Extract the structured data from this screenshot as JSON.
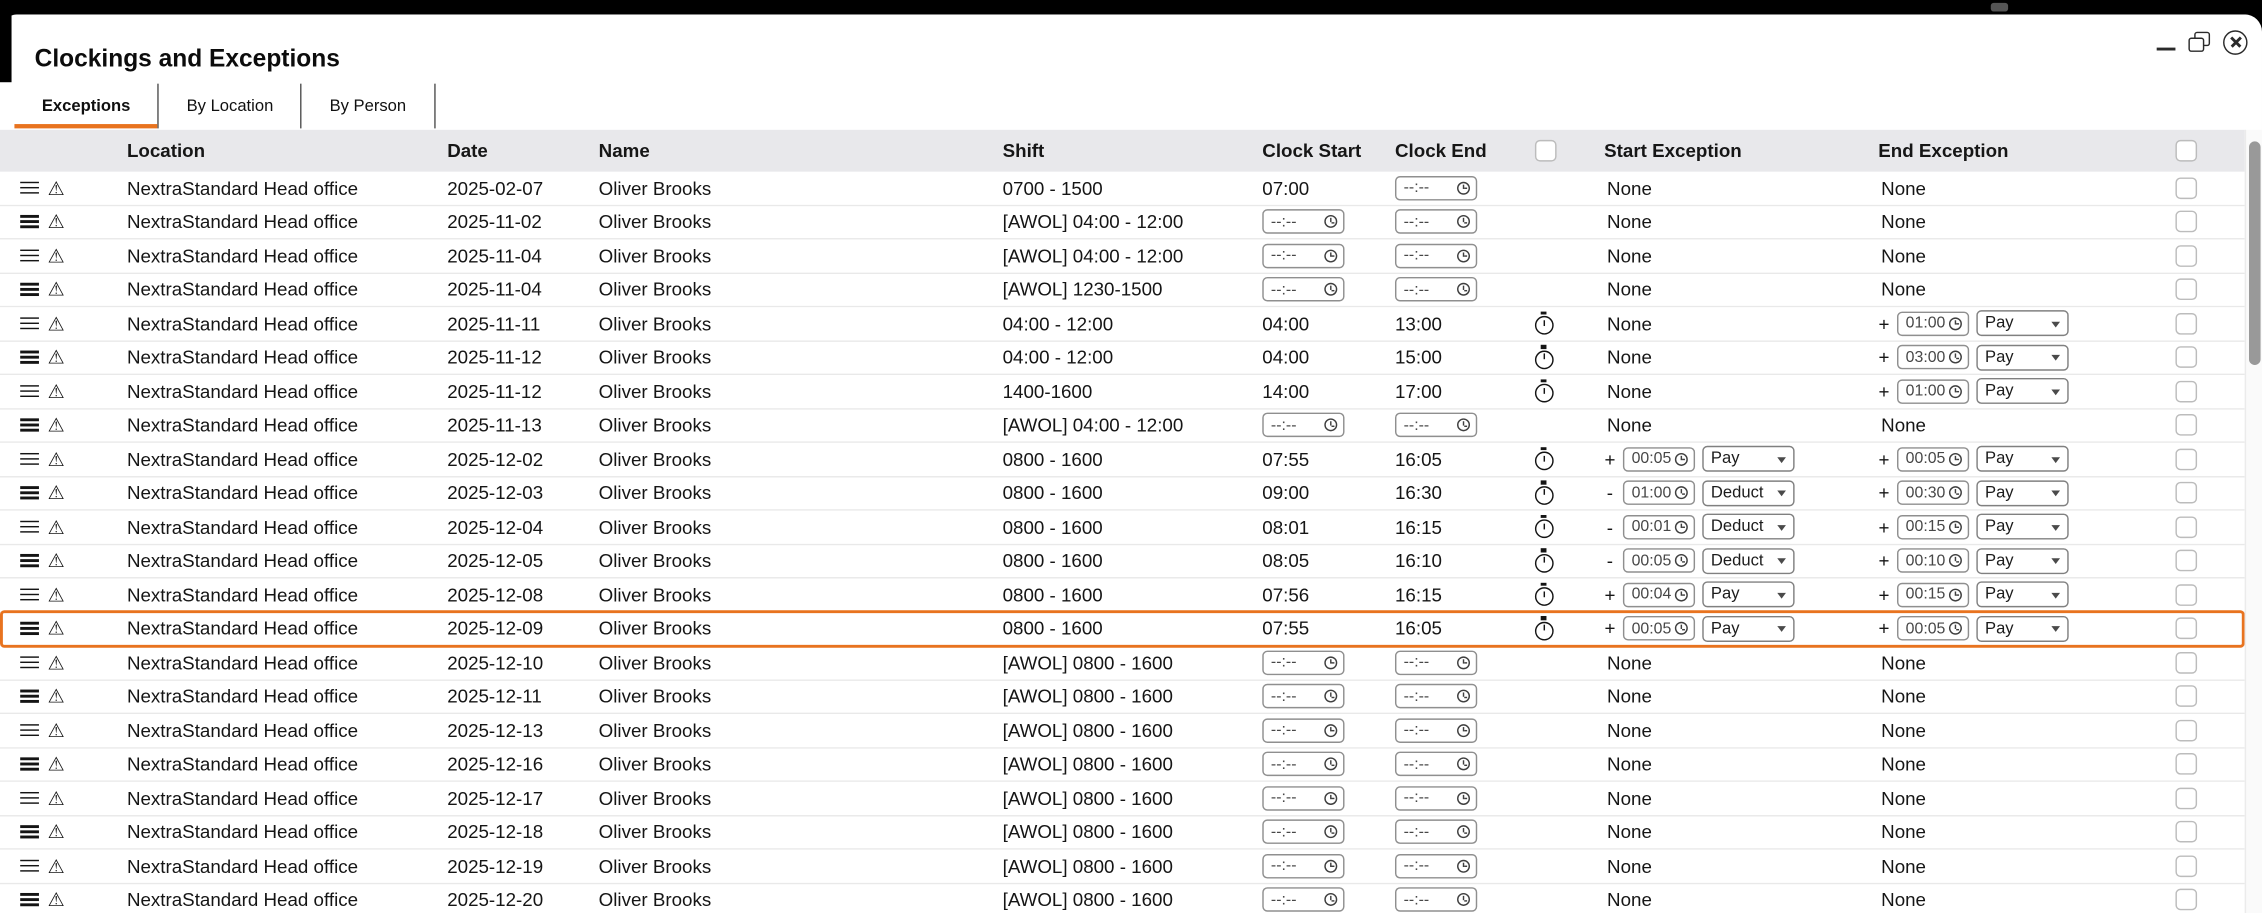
{
  "window": {
    "title": "Clockings and Exceptions"
  },
  "tabs": [
    {
      "label": "Exceptions",
      "active": true
    },
    {
      "label": "By Location",
      "active": false
    },
    {
      "label": "By Person",
      "active": false
    }
  ],
  "icons": {
    "warning": "⚠"
  },
  "colors": {
    "accent": "#e8731f",
    "header_bg": "#e8e8eb"
  },
  "table": {
    "headers": {
      "location": "Location",
      "date": "Date",
      "name": "Name",
      "shift": "Shift",
      "clock_start": "Clock Start",
      "clock_end": "Clock End",
      "start_exception": "Start Exception",
      "end_exception": "End Exception"
    },
    "none_label": "None",
    "time_placeholder": "--:--",
    "rows": [
      {
        "location": "NextraStandard Head office",
        "date": "2025-02-07",
        "name": "Oliver Brooks",
        "shift": "0700 - 1500",
        "clock_start": "07:00",
        "clock_end": null,
        "timer_icon": false,
        "start_exception": null,
        "end_exception": null,
        "highlighted": false
      },
      {
        "location": "NextraStandard Head office",
        "date": "2025-11-02",
        "name": "Oliver Brooks",
        "shift": "[AWOL] 04:00 - 12:00",
        "clock_start": null,
        "clock_end": null,
        "timer_icon": false,
        "start_exception": null,
        "end_exception": null,
        "highlighted": false
      },
      {
        "location": "NextraStandard Head office",
        "date": "2025-11-04",
        "name": "Oliver Brooks",
        "shift": "[AWOL] 04:00 - 12:00",
        "clock_start": null,
        "clock_end": null,
        "timer_icon": false,
        "start_exception": null,
        "end_exception": null,
        "highlighted": false
      },
      {
        "location": "NextraStandard Head office",
        "date": "2025-11-04",
        "name": "Oliver Brooks",
        "shift": "[AWOL] 1230-1500",
        "clock_start": null,
        "clock_end": null,
        "timer_icon": false,
        "start_exception": null,
        "end_exception": null,
        "highlighted": false
      },
      {
        "location": "NextraStandard Head office",
        "date": "2025-11-11",
        "name": "Oliver Brooks",
        "shift": "04:00 - 12:00",
        "clock_start": "04:00",
        "clock_end": "13:00",
        "timer_icon": true,
        "start_exception": null,
        "end_exception": {
          "sign": "+",
          "time": "01:00",
          "action": "Pay"
        },
        "highlighted": false
      },
      {
        "location": "NextraStandard Head office",
        "date": "2025-11-12",
        "name": "Oliver Brooks",
        "shift": "04:00 - 12:00",
        "clock_start": "04:00",
        "clock_end": "15:00",
        "timer_icon": true,
        "start_exception": null,
        "end_exception": {
          "sign": "+",
          "time": "03:00",
          "action": "Pay"
        },
        "highlighted": false
      },
      {
        "location": "NextraStandard Head office",
        "date": "2025-11-12",
        "name": "Oliver Brooks",
        "shift": "1400-1600",
        "clock_start": "14:00",
        "clock_end": "17:00",
        "timer_icon": true,
        "start_exception": null,
        "end_exception": {
          "sign": "+",
          "time": "01:00",
          "action": "Pay"
        },
        "highlighted": false
      },
      {
        "location": "NextraStandard Head office",
        "date": "2025-11-13",
        "name": "Oliver Brooks",
        "shift": "[AWOL] 04:00 - 12:00",
        "clock_start": null,
        "clock_end": null,
        "timer_icon": false,
        "start_exception": null,
        "end_exception": null,
        "highlighted": false
      },
      {
        "location": "NextraStandard Head office",
        "date": "2025-12-02",
        "name": "Oliver Brooks",
        "shift": "0800 - 1600",
        "clock_start": "07:55",
        "clock_end": "16:05",
        "timer_icon": true,
        "start_exception": {
          "sign": "+",
          "time": "00:05",
          "action": "Pay"
        },
        "end_exception": {
          "sign": "+",
          "time": "00:05",
          "action": "Pay"
        },
        "highlighted": false
      },
      {
        "location": "NextraStandard Head office",
        "date": "2025-12-03",
        "name": "Oliver Brooks",
        "shift": "0800 - 1600",
        "clock_start": "09:00",
        "clock_end": "16:30",
        "timer_icon": true,
        "start_exception": {
          "sign": "-",
          "time": "01:00",
          "action": "Deduct"
        },
        "end_exception": {
          "sign": "+",
          "time": "00:30",
          "action": "Pay"
        },
        "highlighted": false
      },
      {
        "location": "NextraStandard Head office",
        "date": "2025-12-04",
        "name": "Oliver Brooks",
        "shift": "0800 - 1600",
        "clock_start": "08:01",
        "clock_end": "16:15",
        "timer_icon": true,
        "start_exception": {
          "sign": "-",
          "time": "00:01",
          "action": "Deduct"
        },
        "end_exception": {
          "sign": "+",
          "time": "00:15",
          "action": "Pay"
        },
        "highlighted": false
      },
      {
        "location": "NextraStandard Head office",
        "date": "2025-12-05",
        "name": "Oliver Brooks",
        "shift": "0800 - 1600",
        "clock_start": "08:05",
        "clock_end": "16:10",
        "timer_icon": true,
        "start_exception": {
          "sign": "-",
          "time": "00:05",
          "action": "Deduct"
        },
        "end_exception": {
          "sign": "+",
          "time": "00:10",
          "action": "Pay"
        },
        "highlighted": false
      },
      {
        "location": "NextraStandard Head office",
        "date": "2025-12-08",
        "name": "Oliver Brooks",
        "shift": "0800 - 1600",
        "clock_start": "07:56",
        "clock_end": "16:15",
        "timer_icon": true,
        "start_exception": {
          "sign": "+",
          "time": "00:04",
          "action": "Pay"
        },
        "end_exception": {
          "sign": "+",
          "time": "00:15",
          "action": "Pay"
        },
        "highlighted": false
      },
      {
        "location": "NextraStandard Head office",
        "date": "2025-12-09",
        "name": "Oliver Brooks",
        "shift": "0800 - 1600",
        "clock_start": "07:55",
        "clock_end": "16:05",
        "timer_icon": true,
        "start_exception": {
          "sign": "+",
          "time": "00:05",
          "action": "Pay"
        },
        "end_exception": {
          "sign": "+",
          "time": "00:05",
          "action": "Pay"
        },
        "highlighted": true
      },
      {
        "location": "NextraStandard Head office",
        "date": "2025-12-10",
        "name": "Oliver Brooks",
        "shift": "[AWOL] 0800 - 1600",
        "clock_start": null,
        "clock_end": null,
        "timer_icon": false,
        "start_exception": null,
        "end_exception": null,
        "highlighted": false
      },
      {
        "location": "NextraStandard Head office",
        "date": "2025-12-11",
        "name": "Oliver Brooks",
        "shift": "[AWOL] 0800 - 1600",
        "clock_start": null,
        "clock_end": null,
        "timer_icon": false,
        "start_exception": null,
        "end_exception": null,
        "highlighted": false
      },
      {
        "location": "NextraStandard Head office",
        "date": "2025-12-13",
        "name": "Oliver Brooks",
        "shift": "[AWOL] 0800 - 1600",
        "clock_start": null,
        "clock_end": null,
        "timer_icon": false,
        "start_exception": null,
        "end_exception": null,
        "highlighted": false
      },
      {
        "location": "NextraStandard Head office",
        "date": "2025-12-16",
        "name": "Oliver Brooks",
        "shift": "[AWOL] 0800 - 1600",
        "clock_start": null,
        "clock_end": null,
        "timer_icon": false,
        "start_exception": null,
        "end_exception": null,
        "highlighted": false
      },
      {
        "location": "NextraStandard Head office",
        "date": "2025-12-17",
        "name": "Oliver Brooks",
        "shift": "[AWOL] 0800 - 1600",
        "clock_start": null,
        "clock_end": null,
        "timer_icon": false,
        "start_exception": null,
        "end_exception": null,
        "highlighted": false
      },
      {
        "location": "NextraStandard Head office",
        "date": "2025-12-18",
        "name": "Oliver Brooks",
        "shift": "[AWOL] 0800 - 1600",
        "clock_start": null,
        "clock_end": null,
        "timer_icon": false,
        "start_exception": null,
        "end_exception": null,
        "highlighted": false
      },
      {
        "location": "NextraStandard Head office",
        "date": "2025-12-19",
        "name": "Oliver Brooks",
        "shift": "[AWOL] 0800 - 1600",
        "clock_start": null,
        "clock_end": null,
        "timer_icon": false,
        "start_exception": null,
        "end_exception": null,
        "highlighted": false
      },
      {
        "location": "NextraStandard Head office",
        "date": "2025-12-20",
        "name": "Oliver Brooks",
        "shift": "[AWOL] 0800 - 1600",
        "clock_start": null,
        "clock_end": null,
        "timer_icon": false,
        "start_exception": null,
        "end_exception": null,
        "highlighted": false
      }
    ]
  }
}
